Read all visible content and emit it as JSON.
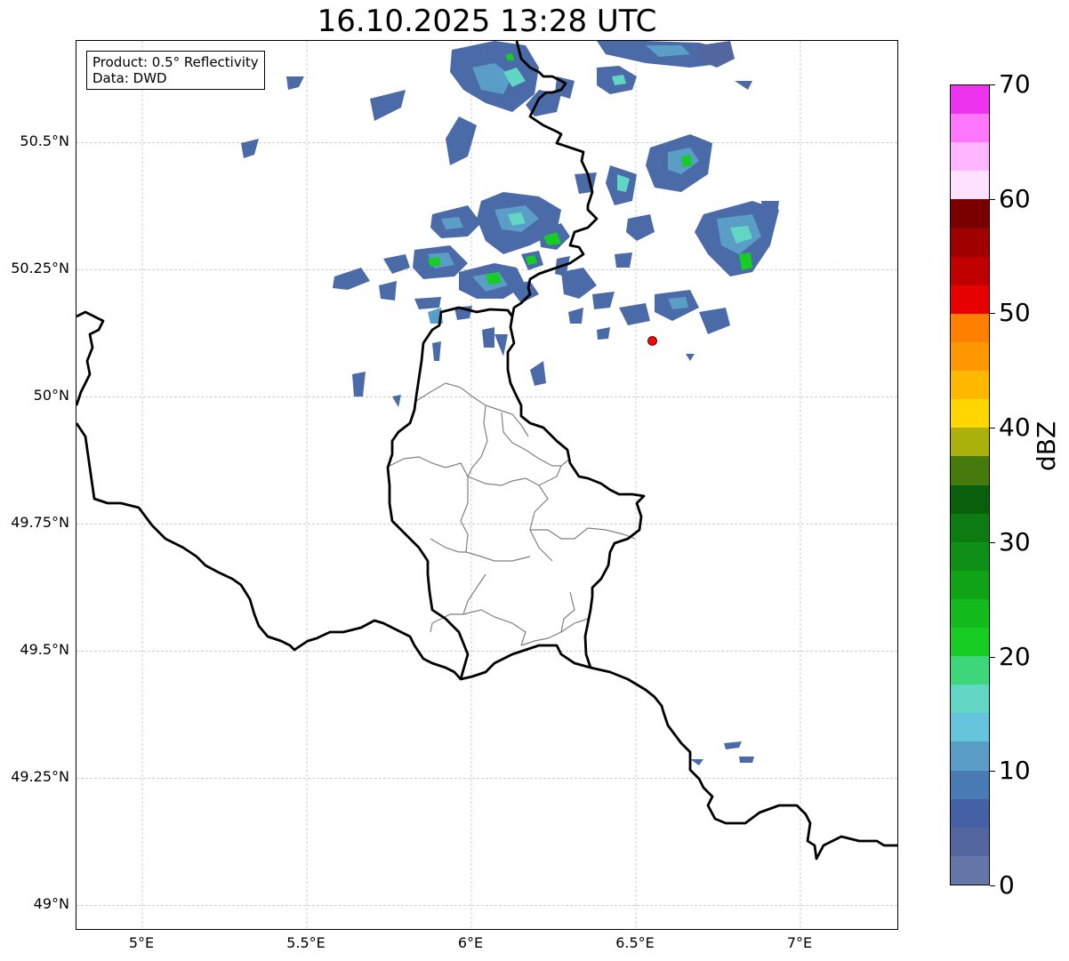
{
  "title": "16.10.2025 13:28 UTC",
  "info": {
    "product": "Product: 0.5° Reflectivity",
    "data": "Data: DWD"
  },
  "map": {
    "lon_range": [
      4.8,
      7.3
    ],
    "lat_range": [
      48.95,
      50.7
    ],
    "lat_ticks": [
      {
        "value": 50.5,
        "label": "50.5°N"
      },
      {
        "value": 50.25,
        "label": "50.25°N"
      },
      {
        "value": 50.0,
        "label": "50°N"
      },
      {
        "value": 49.75,
        "label": "49.75°N"
      },
      {
        "value": 49.5,
        "label": "49.5°N"
      },
      {
        "value": 49.25,
        "label": "49.25°N"
      },
      {
        "value": 49.0,
        "label": "49°N"
      }
    ],
    "lon_ticks": [
      {
        "value": 5.0,
        "label": "5°E"
      },
      {
        "value": 5.5,
        "label": "5.5°E"
      },
      {
        "value": 6.0,
        "label": "6°E"
      },
      {
        "value": 6.5,
        "label": "6.5°E"
      },
      {
        "value": 7.0,
        "label": "7°E"
      }
    ],
    "radar_site": {
      "lon": 6.55,
      "lat": 50.11,
      "color": "#ff0000"
    },
    "border_color": "#000000",
    "admin_border_color": "#808080",
    "grid": true
  },
  "colorbar": {
    "unit": "dBZ",
    "min": 0,
    "max": 70,
    "step": 2.5,
    "tick_labels": [
      "0",
      "10",
      "20",
      "30",
      "40",
      "50",
      "60",
      "70"
    ],
    "tick_values": [
      0,
      10,
      20,
      30,
      40,
      50,
      60,
      70
    ],
    "colors": [
      "#6577a8",
      "#5466a0",
      "#4461a6",
      "#4a7ab4",
      "#5a9ec8",
      "#66c3dc",
      "#61d6c4",
      "#3dd67a",
      "#17cc23",
      "#13bb1d",
      "#10a318",
      "#0f8f16",
      "#0c7b12",
      "#095f0c",
      "#467a0c",
      "#aab10a",
      "#ffd600",
      "#ffb700",
      "#ff9800",
      "#ff7f00",
      "#e60000",
      "#c00000",
      "#a00000",
      "#7a0000",
      "#ffe0ff",
      "#ffb5ff",
      "#ff77ff",
      "#ee33ee"
    ]
  }
}
